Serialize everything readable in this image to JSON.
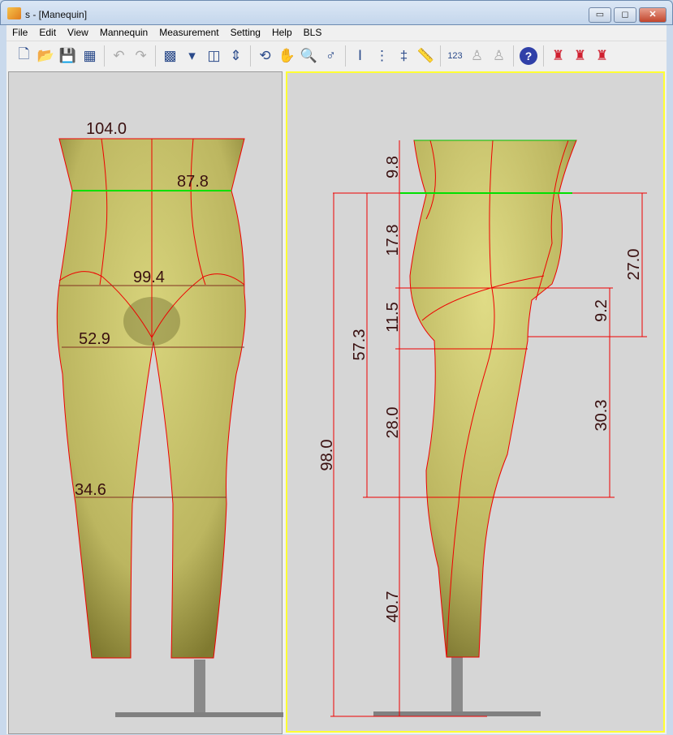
{
  "window": {
    "title": "s - [Manequin]",
    "minimize": "▭",
    "maximize": "◻",
    "close": "✕"
  },
  "menu": [
    "File",
    "Edit",
    "View",
    "Mannequin",
    "Measurement",
    "Setting",
    "Help",
    "BLS"
  ],
  "toolbar": [
    {
      "icon": "new-file-icon",
      "glyph": "🗋"
    },
    {
      "icon": "open-folder-icon",
      "glyph": "📂"
    },
    {
      "icon": "save-icon",
      "glyph": "💾"
    },
    {
      "icon": "export-icon",
      "glyph": "▦"
    },
    {
      "icon": "undo-icon",
      "glyph": "↶"
    },
    {
      "icon": "redo-icon",
      "glyph": "↷"
    },
    {
      "icon": "texture-icon",
      "glyph": "▩"
    },
    {
      "icon": "dropdown-arrow-icon",
      "glyph": "▾"
    },
    {
      "icon": "layout-icon",
      "glyph": "◫"
    },
    {
      "icon": "height-figure-icon",
      "glyph": "⇕"
    },
    {
      "icon": "rotate-icon",
      "glyph": "⟲"
    },
    {
      "icon": "pan-hand-icon",
      "glyph": "✋"
    },
    {
      "icon": "zoom-icon",
      "glyph": "🔍"
    },
    {
      "icon": "gender-icon",
      "glyph": "♂"
    },
    {
      "icon": "measure-vertical-icon",
      "glyph": "Ⅰ"
    },
    {
      "icon": "measure-dotted-icon",
      "glyph": "⋮"
    },
    {
      "icon": "measure-cross-icon",
      "glyph": "‡"
    },
    {
      "icon": "ruler-icon",
      "glyph": "📏"
    },
    {
      "icon": "numbers-123-icon",
      "glyph": "123"
    },
    {
      "icon": "body-height-icon",
      "glyph": "♙"
    },
    {
      "icon": "add-body-icon",
      "glyph": "♙"
    },
    {
      "icon": "help-icon",
      "glyph": "?"
    },
    {
      "icon": "mannequin-height-icon",
      "glyph": "♜"
    },
    {
      "icon": "mannequin-edit-icon",
      "glyph": "♜"
    },
    {
      "icon": "mannequin-line-icon",
      "glyph": "♜"
    }
  ],
  "front_view": {
    "labels": {
      "waist_top": "104.0",
      "waist": "87.8",
      "hip": "99.4",
      "thigh": "52.9",
      "knee": "34.6"
    }
  },
  "side_view": {
    "labels": {
      "a": "9.8",
      "b": "17.8",
      "c": "11.5",
      "d": "57.3",
      "e": "28.0",
      "f": "98.0",
      "g": "40.7",
      "h": "27.0",
      "i": "9.2",
      "j": "30.3"
    }
  },
  "colors": {
    "body": "#c8c46a",
    "measure": "#ff0000",
    "waist_line": "#00e000",
    "active_border": "#ffff33"
  }
}
